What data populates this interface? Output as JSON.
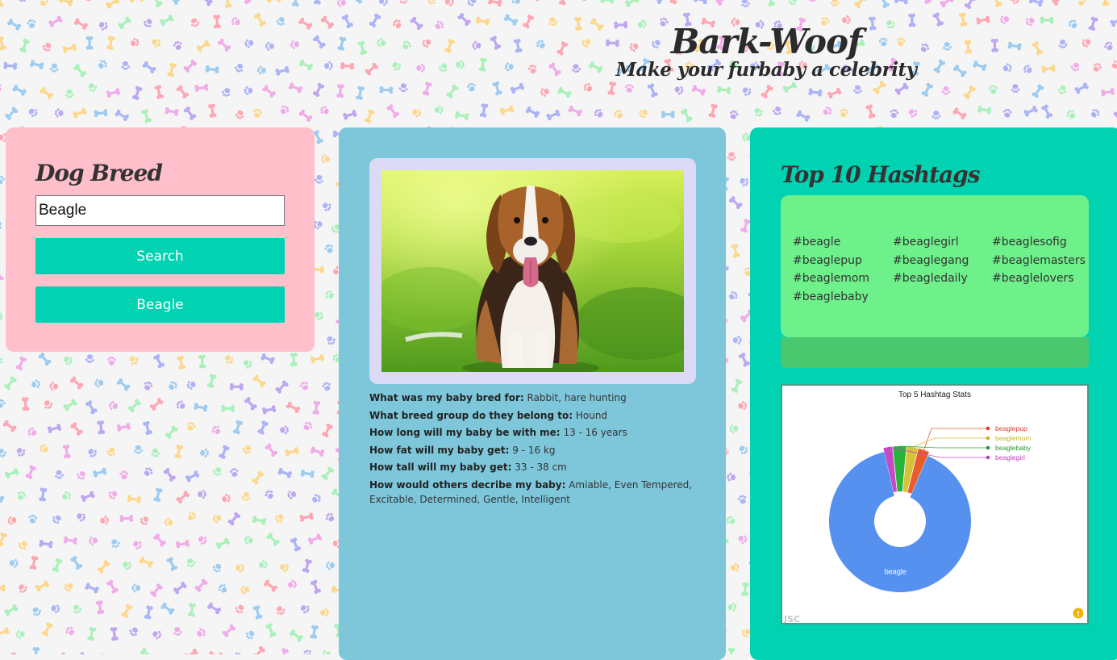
{
  "header": {
    "title": "Bark-Woof",
    "tagline": "Make your furbaby a celebrity"
  },
  "breed_panel": {
    "heading": "Dog Breed",
    "search_value": "Beagle",
    "search_button": "Search",
    "breed_button": "Beagle"
  },
  "info_panel": {
    "facts": [
      {
        "label": "What was my baby bred for:",
        "value": "Rabbit, hare hunting"
      },
      {
        "label": "What breed group do they belong to:",
        "value": "Hound"
      },
      {
        "label": "How long will my baby be with me:",
        "value": "13 - 16 years"
      },
      {
        "label": "How fat will my baby get:",
        "value": "9 - 16 kg"
      },
      {
        "label": "How tall will my baby get:",
        "value": "33 - 38 cm"
      },
      {
        "label": "How would others decribe my baby:",
        "value": "Amiable, Even Tempered, Excitable, Determined, Gentle, Intelligent"
      }
    ]
  },
  "hashtag_panel": {
    "heading": "Top 10 Hashtags",
    "tags": [
      "#beagle",
      "#beaglegirl",
      "#beaglesofig",
      "#beaglepup",
      "#beaglegang",
      "#beaglemasters",
      "#beaglemom",
      "#beagledaily",
      "#beaglelovers",
      "#beaglebaby"
    ]
  },
  "chart_data": {
    "type": "pie",
    "title": "Top 5 Hashtag Stats",
    "categories": [
      "beagle",
      "beaglepup",
      "beaglemom",
      "beaglebaby",
      "beaglegirl"
    ],
    "values": [
      90,
      2.5,
      2.5,
      3,
      2
    ],
    "colors": [
      "#5691f0",
      "#e85c2c",
      "#d6c13a",
      "#29b33a",
      "#c44bc4"
    ],
    "label_colors": [
      "#ffffff",
      "#e0392b",
      "#c9b71a",
      "#2a9a34",
      "#c03fbf"
    ],
    "donut": true,
    "credit": "JSC"
  }
}
